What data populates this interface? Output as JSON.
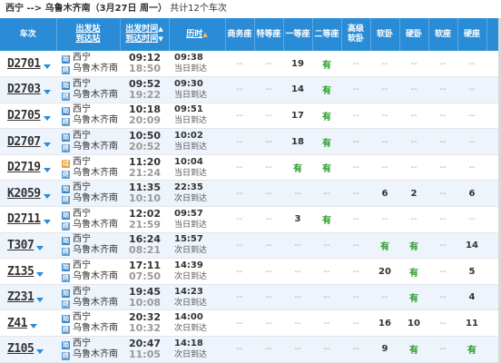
{
  "summary": {
    "route": "西宁 --> 乌鲁木齐南（3月27日  周一）",
    "count": "共计12个车次"
  },
  "headers": {
    "train": "车次",
    "from_station": "出发站",
    "to_station": "到达站",
    "dep_time": "出发时间",
    "arr_time": "到达时间",
    "duration": "历时",
    "business": "商务座",
    "special": "特等座",
    "first": "一等座",
    "second": "二等座",
    "premium_sleeper_1": "高级",
    "premium_sleeper_2": "软卧",
    "soft_sleeper": "软卧",
    "hard_sleeper": "硬卧",
    "soft_seat": "软座",
    "hard_seat": "硬座"
  },
  "colors": {
    "header_bg": "#2a8cd6",
    "available": "#2a9e2a",
    "sort_arrow": "#ffb84d"
  },
  "trains": [
    {
      "no": "D2701",
      "from": "西宁",
      "to": "乌鲁木齐南",
      "from_icon": "start",
      "dep": "09:12",
      "arr": "18:50",
      "dur": "09:38",
      "arrive_day": "当日到达",
      "business": "--",
      "special": "--",
      "first": "19",
      "second": "有",
      "premium": "--",
      "soft_sleeper": "--",
      "hard_sleeper": "--",
      "soft_seat": "--",
      "hard_seat": "--"
    },
    {
      "no": "D2703",
      "from": "西宁",
      "to": "乌鲁木齐南",
      "from_icon": "start",
      "dep": "09:52",
      "arr": "19:22",
      "dur": "09:30",
      "arrive_day": "当日到达",
      "business": "--",
      "special": "--",
      "first": "14",
      "second": "有",
      "premium": "--",
      "soft_sleeper": "--",
      "hard_sleeper": "--",
      "soft_seat": "--",
      "hard_seat": "--"
    },
    {
      "no": "D2705",
      "from": "西宁",
      "to": "乌鲁木齐南",
      "from_icon": "start",
      "dep": "10:18",
      "arr": "20:09",
      "dur": "09:51",
      "arrive_day": "当日到达",
      "business": "--",
      "special": "--",
      "first": "17",
      "second": "有",
      "premium": "--",
      "soft_sleeper": "--",
      "hard_sleeper": "--",
      "soft_seat": "--",
      "hard_seat": "--"
    },
    {
      "no": "D2707",
      "from": "西宁",
      "to": "乌鲁木齐南",
      "from_icon": "start",
      "dep": "10:50",
      "arr": "20:52",
      "dur": "10:02",
      "arrive_day": "当日到达",
      "business": "--",
      "special": "--",
      "first": "18",
      "second": "有",
      "premium": "--",
      "soft_sleeper": "--",
      "hard_sleeper": "--",
      "soft_seat": "--",
      "hard_seat": "--"
    },
    {
      "no": "D2719",
      "from": "西宁",
      "to": "乌鲁木齐南",
      "from_icon": "pass",
      "dep": "11:20",
      "arr": "21:24",
      "dur": "10:04",
      "arrive_day": "当日到达",
      "business": "--",
      "special": "--",
      "first": "有",
      "second": "有",
      "premium": "--",
      "soft_sleeper": "--",
      "hard_sleeper": "--",
      "soft_seat": "--",
      "hard_seat": "--"
    },
    {
      "no": "K2059",
      "from": "西宁",
      "to": "乌鲁木齐南",
      "from_icon": "start",
      "dep": "11:35",
      "arr": "10:10",
      "dur": "22:35",
      "arrive_day": "次日到达",
      "business": "--",
      "special": "--",
      "first": "--",
      "second": "--",
      "premium": "--",
      "soft_sleeper": "6",
      "hard_sleeper": "2",
      "soft_seat": "--",
      "hard_seat": "6"
    },
    {
      "no": "D2711",
      "from": "西宁",
      "to": "乌鲁木齐南",
      "from_icon": "start",
      "dep": "12:02",
      "arr": "21:59",
      "dur": "09:57",
      "arrive_day": "当日到达",
      "business": "--",
      "special": "--",
      "first": "3",
      "second": "有",
      "premium": "--",
      "soft_sleeper": "--",
      "hard_sleeper": "--",
      "soft_seat": "--",
      "hard_seat": "--"
    },
    {
      "no": "T307",
      "from": "西宁",
      "to": "乌鲁木齐南",
      "from_icon": "start",
      "dep": "16:24",
      "arr": "08:21",
      "dur": "15:57",
      "arrive_day": "次日到达",
      "business": "--",
      "special": "--",
      "first": "--",
      "second": "--",
      "premium": "--",
      "soft_sleeper": "有",
      "hard_sleeper": "有",
      "soft_seat": "--",
      "hard_seat": "14"
    },
    {
      "no": "Z135",
      "from": "西宁",
      "to": "乌鲁木齐南",
      "from_icon": "start",
      "dep": "17:11",
      "arr": "07:50",
      "dur": "14:39",
      "arrive_day": "次日到达",
      "business": "--",
      "special": "--",
      "first": "--",
      "second": "--",
      "premium": "--",
      "soft_sleeper": "20",
      "hard_sleeper": "有",
      "soft_seat": "--",
      "hard_seat": "5"
    },
    {
      "no": "Z231",
      "from": "西宁",
      "to": "乌鲁木齐南",
      "from_icon": "start",
      "dep": "19:45",
      "arr": "10:08",
      "dur": "14:23",
      "arrive_day": "次日到达",
      "business": "--",
      "special": "--",
      "first": "--",
      "second": "--",
      "premium": "--",
      "soft_sleeper": "--",
      "hard_sleeper": "有",
      "soft_seat": "--",
      "hard_seat": "4"
    },
    {
      "no": "Z41",
      "from": "西宁",
      "to": "乌鲁木齐南",
      "from_icon": "start",
      "dep": "20:32",
      "arr": "10:32",
      "dur": "14:00",
      "arrive_day": "次日到达",
      "business": "--",
      "special": "--",
      "first": "--",
      "second": "--",
      "premium": "--",
      "soft_sleeper": "16",
      "hard_sleeper": "10",
      "soft_seat": "--",
      "hard_seat": "11"
    },
    {
      "no": "Z105",
      "from": "西宁",
      "to": "乌鲁木齐南",
      "from_icon": "start",
      "dep": "20:47",
      "arr": "11:05",
      "dur": "14:18",
      "arrive_day": "次日到达",
      "business": "--",
      "special": "--",
      "first": "--",
      "second": "--",
      "premium": "--",
      "soft_sleeper": "9",
      "hard_sleeper": "有",
      "soft_seat": "--",
      "hard_seat": "有"
    }
  ]
}
